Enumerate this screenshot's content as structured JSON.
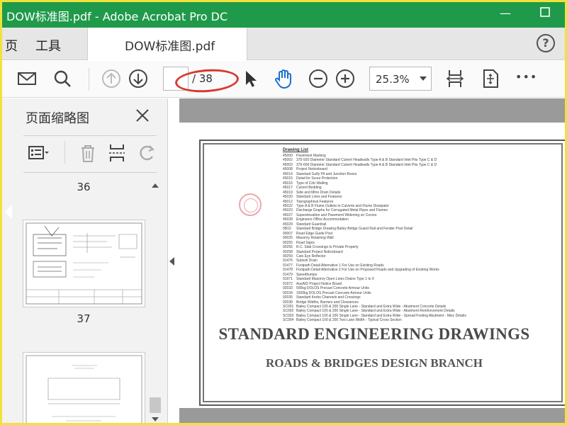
{
  "window": {
    "title": "DOW标准图.pdf - Adobe Acrobat Pro DC",
    "minimize_icon": "minimize-icon",
    "maximize_icon": "maximize-icon"
  },
  "tabs": {
    "home": "页",
    "tools": "工具",
    "document": "DOW标准图.pdf",
    "help": "?"
  },
  "toolbar": {
    "page_current": "",
    "page_total": "/ 38",
    "zoom": "25.3%",
    "more": "•••",
    "icons": [
      "mail-icon",
      "search-icon",
      "page-up-icon",
      "page-down-icon",
      "select-cursor-icon",
      "hand-icon",
      "zoom-out-icon",
      "zoom-in-icon",
      "fit-width-icon",
      "fit-page-icon",
      "more-icon"
    ]
  },
  "left_panel": {
    "title": "页面缩略图",
    "page_labels": [
      "36",
      "37"
    ]
  },
  "document": {
    "list_title": "Drawing List",
    "list": [
      [
        "45000",
        "Pavement Marking"
      ],
      [
        "45002",
        "375-920 Diameter Standard Culvert Headwalls Type A & B Standard Inlet Pits Type C & D"
      ],
      [
        "45003",
        "375-600 Diameter Standard Culvert Headwalls Type A & B Standard Inlet Pits Type C & D"
      ],
      [
        "45008",
        "Project Noticeboard"
      ],
      [
        "45014",
        "Standard Gully Pit and Junction Boxes"
      ],
      [
        "45015",
        "Detail for Scour Protection"
      ],
      [
        "45016",
        "Type of Crib Walling"
      ],
      [
        "45017",
        "Culvert Bedding"
      ],
      [
        "45019",
        "Side and Mitre Drain Details"
      ],
      [
        "45020",
        "Standard Lines and Features"
      ],
      [
        "45012",
        "Topographical Features"
      ],
      [
        "45022",
        "Type A & B Flume Outlets to Culverts and Flume Dissipator"
      ],
      [
        "45023",
        "Discharge Graphs for Corrugated Metal Pipes and Flumes"
      ],
      [
        "45027",
        "Superelevation and Pavement Widening on Curves"
      ],
      [
        "45028",
        "Engineers Office Accommodation"
      ],
      [
        "45029",
        "Standard Guardrail"
      ],
      [
        "5B10",
        "Standard Bridge Drawing Bailey Bridge Guard Rail and Fender Post Detail"
      ],
      [
        "90007",
        "Road Edge Guide Post"
      ],
      [
        "90025",
        "Masonry Retaining Wall"
      ],
      [
        "90255",
        "Road Signs"
      ],
      [
        "90256",
        "R.C. Slab Crossings to Private Property"
      ],
      [
        "90258",
        "Standard Project Noticeboard"
      ],
      [
        "90259",
        "Cats Eye Reflector"
      ],
      [
        "91476",
        "Subsoil Drain"
      ],
      [
        "91477",
        "Footpath Detail Alternative 1 For Use on Existing Roads"
      ],
      [
        "91478",
        "Footpath Detail Alternative 2 For Use on Proposed Roads and Upgrading of Existing Works"
      ],
      [
        "91479",
        "Speedhumps"
      ],
      [
        "91971",
        "Standard Masonry Open Lines Drains Type 1 to 9"
      ],
      [
        "91972",
        "AusAID Project Notice Board"
      ],
      [
        "92033",
        "500kg DOLOS Precast Concrete Armour Units"
      ],
      [
        "92034",
        "1500kg DOLOS Precast Concrete Armour Units"
      ],
      [
        "92035",
        "Standard Kerbs Channels and Crossings"
      ],
      [
        "92038",
        "Bridge Widths, Barriers and Clearances"
      ],
      [
        "SC001",
        "Bailey Compact 100 & 200 Single Lane - Standard and Extra Wide - Abutment Concrete Details"
      ],
      [
        "SC002",
        "Bailey Compact 100 & 200 Single Lane - Standard and Extra Wide - Abutment Reinforcement Details"
      ],
      [
        "SC003",
        "Bailey Compact 100 & 200 Single Lane - Standard and Extra Wide - Spread Footing Abutment - Misc Details"
      ],
      [
        "SC004",
        "Bailey Compact 100 & 200 Two Lane Width - Typical Cross Section"
      ]
    ],
    "heading": "STANDARD ENGINEERING DRAWINGS",
    "subheading": "ROADS & BRIDGES DESIGN BRANCH"
  },
  "colors": {
    "title_bar": "#1f9a4a",
    "outer_border": "#f1e23a",
    "annotation_ellipse": "#d83a2f",
    "hand_tool": "#1a6fd1"
  }
}
